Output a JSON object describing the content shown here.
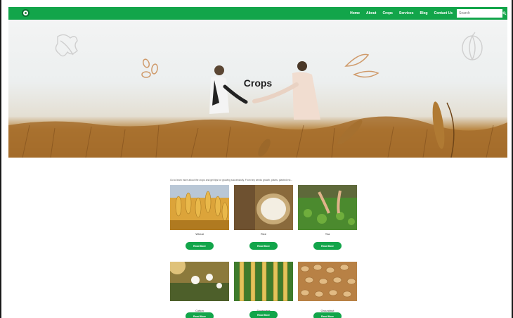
{
  "nav": {
    "links": [
      "Home",
      "About",
      "Crops",
      "Services",
      "Blog",
      "Contact Us"
    ],
    "search_placeholder": "Search"
  },
  "hero": {
    "title": "Crops"
  },
  "intro": "Go to learn more about the crops and get tips for growing successfully. From tiny seeds growth, plants, planted etc...",
  "crops": [
    {
      "name": "Wheat",
      "button": "Read More"
    },
    {
      "name": "Rice",
      "button": "Read More"
    },
    {
      "name": "Tea",
      "button": "Read More"
    },
    {
      "name": "Cotton",
      "button": "Read More"
    },
    {
      "name": "Sugarcane",
      "button": "Read More"
    },
    {
      "name": "Groundnut",
      "button": "Read More"
    }
  ],
  "colors": {
    "brand": "#12a54a",
    "field": "#b07a33"
  }
}
